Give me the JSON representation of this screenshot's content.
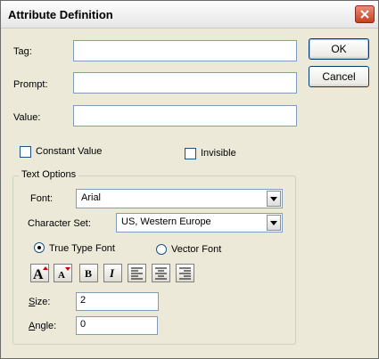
{
  "window": {
    "title": "Attribute Definition"
  },
  "fields": {
    "tag": {
      "label": "Tag:",
      "value": ""
    },
    "prompt": {
      "label": "Prompt:",
      "value": ""
    },
    "value": {
      "label": "Value:",
      "value": ""
    }
  },
  "buttons": {
    "ok": "OK",
    "cancel": "Cancel"
  },
  "checkboxes": {
    "constant": {
      "label": "Constant Value",
      "checked": false
    },
    "invisible": {
      "label": "Invisible",
      "checked": false
    }
  },
  "text_options": {
    "legend": "Text Options",
    "font": {
      "label": "Font:",
      "value": "Arial"
    },
    "charset": {
      "label": "Character Set:",
      "value": "US, Western Europe"
    },
    "font_type": {
      "truetype": "True Type Font",
      "vector": "Vector Font",
      "selected": "truetype"
    },
    "format_buttons": [
      "grow-font-icon",
      "shrink-font-icon",
      "bold-icon",
      "italic-icon",
      "align-left-icon",
      "align-center-icon",
      "align-right-icon"
    ],
    "size": {
      "label_first": "S",
      "label_rest": "ize:",
      "value": "2"
    },
    "angle": {
      "label_first": "A",
      "label_rest": "ngle:",
      "value": "0"
    }
  }
}
